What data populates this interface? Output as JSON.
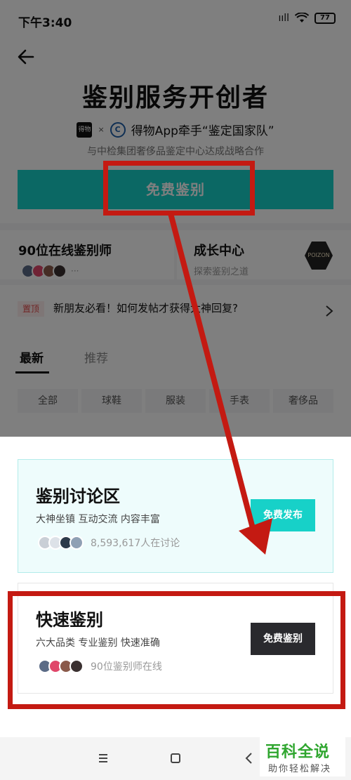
{
  "status_bar": {
    "time": "下午3:40",
    "signal_text": "ııll",
    "battery": "77"
  },
  "hero": {
    "title": "鉴别服务开创者",
    "partner_logo_text": "得物",
    "partner_times": "×",
    "ccic_logo_text": "C",
    "partner_text": "得物App牵手“鉴定国家队”",
    "subtitle": "与中检集团奢侈品鉴定中心达成战略合作",
    "button_label": "免费鉴别"
  },
  "info_cards": {
    "left_title": "90位在线鉴别师",
    "left_more": "···",
    "right_title": "成长中心",
    "right_sub": "探索鉴别之道",
    "badge_text": "POIZON"
  },
  "pinned": {
    "tag": "置顶",
    "text": "新朋友必看！如何发帖才获得大神回复?"
  },
  "feed_tabs": [
    "最新",
    "推荐"
  ],
  "categories": [
    "全部",
    "球鞋",
    "服装",
    "手表",
    "奢侈品"
  ],
  "sheet": {
    "discussion": {
      "title": "鉴别讨论区",
      "desc": "大神坐镇 互动交流 内容丰富",
      "count": "8,593,617人在讨论",
      "button": "免费发布"
    },
    "fast": {
      "title": "快速鉴别",
      "desc": "六大品类 专业鉴别 快速准确",
      "count": "90位鉴别师在线",
      "button": "免费鉴别"
    }
  },
  "watermark": {
    "title": "百科全说",
    "subtitle": "助你轻松解决"
  },
  "colors": {
    "accent": "#17d1c8",
    "annotation": "#c41a12",
    "watermark": "#2fa62f"
  }
}
